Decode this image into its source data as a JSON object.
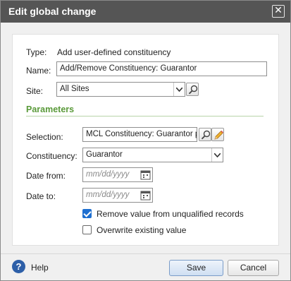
{
  "dialog": {
    "title": "Edit global change",
    "close_glyph": "✕"
  },
  "form": {
    "type_label": "Type:",
    "type_value": "Add user-defined constituency",
    "name_label": "Name:",
    "name_value": "Add/Remove Constituency: Guarantor",
    "site_label": "Site:",
    "site_value": "All Sites",
    "parameters_heading": "Parameters",
    "selection_label": "Selection:",
    "selection_value": "MCL Constituency: Guarantor pl",
    "constituency_label": "Constituency:",
    "constituency_value": "Guarantor",
    "date_from_label": "Date from:",
    "date_from_placeholder": "mm/dd/yyyy",
    "date_to_label": "Date to:",
    "date_to_placeholder": "mm/dd/yyyy",
    "remove_unqualified_label": "Remove value from unqualified records",
    "remove_unqualified_checked": true,
    "overwrite_label": "Overwrite existing value",
    "overwrite_checked": false
  },
  "footer": {
    "help_label": "Help",
    "save_label": "Save",
    "cancel_label": "Cancel"
  },
  "icons": {
    "dropdown": "chevron-down-icon",
    "search": "magnifier-icon",
    "edit": "pencil-icon",
    "calendar": "calendar-icon",
    "help": "question-circle-icon"
  },
  "colors": {
    "titlebar": "#555555",
    "section_heading": "#5a9a3a",
    "checkbox_checked": "#1e6fd0",
    "help_icon": "#2d5fa8"
  }
}
